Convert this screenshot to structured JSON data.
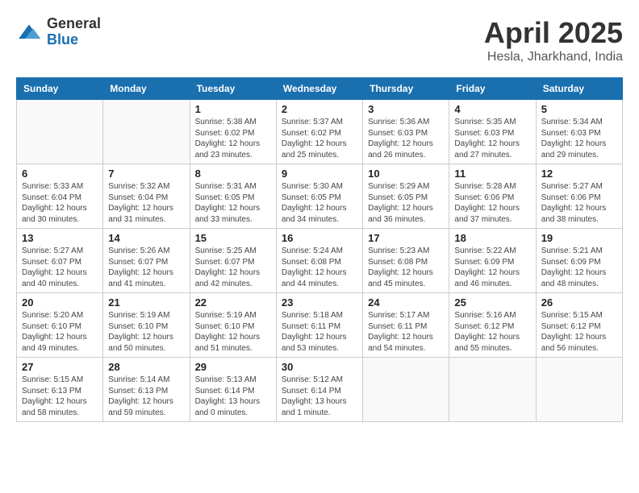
{
  "header": {
    "logo_general": "General",
    "logo_blue": "Blue",
    "month_title": "April 2025",
    "subtitle": "Hesla, Jharkhand, India"
  },
  "days_of_week": [
    "Sunday",
    "Monday",
    "Tuesday",
    "Wednesday",
    "Thursday",
    "Friday",
    "Saturday"
  ],
  "weeks": [
    [
      {
        "day": "",
        "info": ""
      },
      {
        "day": "",
        "info": ""
      },
      {
        "day": "1",
        "info": "Sunrise: 5:38 AM\nSunset: 6:02 PM\nDaylight: 12 hours\nand 23 minutes."
      },
      {
        "day": "2",
        "info": "Sunrise: 5:37 AM\nSunset: 6:02 PM\nDaylight: 12 hours\nand 25 minutes."
      },
      {
        "day": "3",
        "info": "Sunrise: 5:36 AM\nSunset: 6:03 PM\nDaylight: 12 hours\nand 26 minutes."
      },
      {
        "day": "4",
        "info": "Sunrise: 5:35 AM\nSunset: 6:03 PM\nDaylight: 12 hours\nand 27 minutes."
      },
      {
        "day": "5",
        "info": "Sunrise: 5:34 AM\nSunset: 6:03 PM\nDaylight: 12 hours\nand 29 minutes."
      }
    ],
    [
      {
        "day": "6",
        "info": "Sunrise: 5:33 AM\nSunset: 6:04 PM\nDaylight: 12 hours\nand 30 minutes."
      },
      {
        "day": "7",
        "info": "Sunrise: 5:32 AM\nSunset: 6:04 PM\nDaylight: 12 hours\nand 31 minutes."
      },
      {
        "day": "8",
        "info": "Sunrise: 5:31 AM\nSunset: 6:05 PM\nDaylight: 12 hours\nand 33 minutes."
      },
      {
        "day": "9",
        "info": "Sunrise: 5:30 AM\nSunset: 6:05 PM\nDaylight: 12 hours\nand 34 minutes."
      },
      {
        "day": "10",
        "info": "Sunrise: 5:29 AM\nSunset: 6:05 PM\nDaylight: 12 hours\nand 36 minutes."
      },
      {
        "day": "11",
        "info": "Sunrise: 5:28 AM\nSunset: 6:06 PM\nDaylight: 12 hours\nand 37 minutes."
      },
      {
        "day": "12",
        "info": "Sunrise: 5:27 AM\nSunset: 6:06 PM\nDaylight: 12 hours\nand 38 minutes."
      }
    ],
    [
      {
        "day": "13",
        "info": "Sunrise: 5:27 AM\nSunset: 6:07 PM\nDaylight: 12 hours\nand 40 minutes."
      },
      {
        "day": "14",
        "info": "Sunrise: 5:26 AM\nSunset: 6:07 PM\nDaylight: 12 hours\nand 41 minutes."
      },
      {
        "day": "15",
        "info": "Sunrise: 5:25 AM\nSunset: 6:07 PM\nDaylight: 12 hours\nand 42 minutes."
      },
      {
        "day": "16",
        "info": "Sunrise: 5:24 AM\nSunset: 6:08 PM\nDaylight: 12 hours\nand 44 minutes."
      },
      {
        "day": "17",
        "info": "Sunrise: 5:23 AM\nSunset: 6:08 PM\nDaylight: 12 hours\nand 45 minutes."
      },
      {
        "day": "18",
        "info": "Sunrise: 5:22 AM\nSunset: 6:09 PM\nDaylight: 12 hours\nand 46 minutes."
      },
      {
        "day": "19",
        "info": "Sunrise: 5:21 AM\nSunset: 6:09 PM\nDaylight: 12 hours\nand 48 minutes."
      }
    ],
    [
      {
        "day": "20",
        "info": "Sunrise: 5:20 AM\nSunset: 6:10 PM\nDaylight: 12 hours\nand 49 minutes."
      },
      {
        "day": "21",
        "info": "Sunrise: 5:19 AM\nSunset: 6:10 PM\nDaylight: 12 hours\nand 50 minutes."
      },
      {
        "day": "22",
        "info": "Sunrise: 5:19 AM\nSunset: 6:10 PM\nDaylight: 12 hours\nand 51 minutes."
      },
      {
        "day": "23",
        "info": "Sunrise: 5:18 AM\nSunset: 6:11 PM\nDaylight: 12 hours\nand 53 minutes."
      },
      {
        "day": "24",
        "info": "Sunrise: 5:17 AM\nSunset: 6:11 PM\nDaylight: 12 hours\nand 54 minutes."
      },
      {
        "day": "25",
        "info": "Sunrise: 5:16 AM\nSunset: 6:12 PM\nDaylight: 12 hours\nand 55 minutes."
      },
      {
        "day": "26",
        "info": "Sunrise: 5:15 AM\nSunset: 6:12 PM\nDaylight: 12 hours\nand 56 minutes."
      }
    ],
    [
      {
        "day": "27",
        "info": "Sunrise: 5:15 AM\nSunset: 6:13 PM\nDaylight: 12 hours\nand 58 minutes."
      },
      {
        "day": "28",
        "info": "Sunrise: 5:14 AM\nSunset: 6:13 PM\nDaylight: 12 hours\nand 59 minutes."
      },
      {
        "day": "29",
        "info": "Sunrise: 5:13 AM\nSunset: 6:14 PM\nDaylight: 13 hours\nand 0 minutes."
      },
      {
        "day": "30",
        "info": "Sunrise: 5:12 AM\nSunset: 6:14 PM\nDaylight: 13 hours\nand 1 minute."
      },
      {
        "day": "",
        "info": ""
      },
      {
        "day": "",
        "info": ""
      },
      {
        "day": "",
        "info": ""
      }
    ]
  ]
}
